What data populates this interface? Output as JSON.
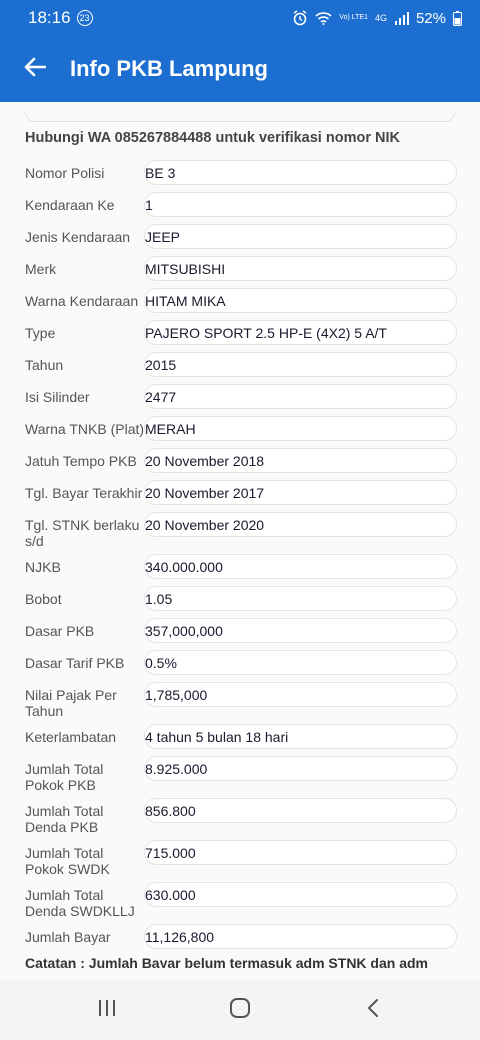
{
  "status": {
    "time": "18:16",
    "badge": "23",
    "battery": "52%",
    "volte": "Vo) LTE1",
    "network": "4G"
  },
  "appbar": {
    "title": "Info PKB Lampung"
  },
  "heading": "Hubungi WA 085267884488 untuk verifikasi nomor NIK",
  "rows": [
    {
      "label": "Nomor Polisi",
      "value": "BE 3"
    },
    {
      "label": "Kendaraan Ke",
      "value": "1"
    },
    {
      "label": "Jenis Kendaraan",
      "value": "JEEP"
    },
    {
      "label": "Merk",
      "value": "MITSUBISHI"
    },
    {
      "label": "Warna Kendaraan",
      "value": "HITAM MIKA"
    },
    {
      "label": "Type",
      "value": "PAJERO SPORT 2.5 HP-E (4X2) 5 A/T"
    },
    {
      "label": "Tahun",
      "value": "2015"
    },
    {
      "label": "Isi Silinder",
      "value": "2477"
    },
    {
      "label": "Warna TNKB (Plat)",
      "value": "MERAH"
    },
    {
      "label": "Jatuh Tempo PKB",
      "value": "20 November 2018"
    },
    {
      "label": "Tgl. Bayar Terakhir",
      "value": "20 November 2017"
    },
    {
      "label": "Tgl. STNK berlaku s/d",
      "value": "20 November 2020"
    },
    {
      "label": "NJKB",
      "value": "340.000.000"
    },
    {
      "label": "Bobot",
      "value": "1.05"
    },
    {
      "label": "Dasar PKB",
      "value": "357,000,000"
    },
    {
      "label": "Dasar Tarif PKB",
      "value": "0.5%"
    },
    {
      "label": "Nilai Pajak Per Tahun",
      "value": "1,785,000"
    },
    {
      "label": "Keterlambatan",
      "value": "4 tahun 5 bulan 18 hari"
    },
    {
      "label": "Jumlah Total Pokok PKB",
      "value": "8.925.000"
    },
    {
      "label": "Jumlah Total Denda PKB",
      "value": "856.800"
    },
    {
      "label": "Jumlah Total Pokok SWDK",
      "value": "715.000"
    },
    {
      "label": "Jumlah Total Denda SWDKLLJ",
      "value": "630.000"
    },
    {
      "label": "Jumlah Bayar",
      "value": "11,126,800"
    }
  ],
  "note": "Catatan : Jumlah Bayar belum termasuk adm STNK dan adm",
  "colors": {
    "primary": "#1c6fd0",
    "background": "#fafafa"
  },
  "icons": {
    "back": "arrow-left",
    "nav_recents": "recents-lines",
    "nav_home": "home-rounded-square",
    "nav_back": "chevron-left"
  }
}
